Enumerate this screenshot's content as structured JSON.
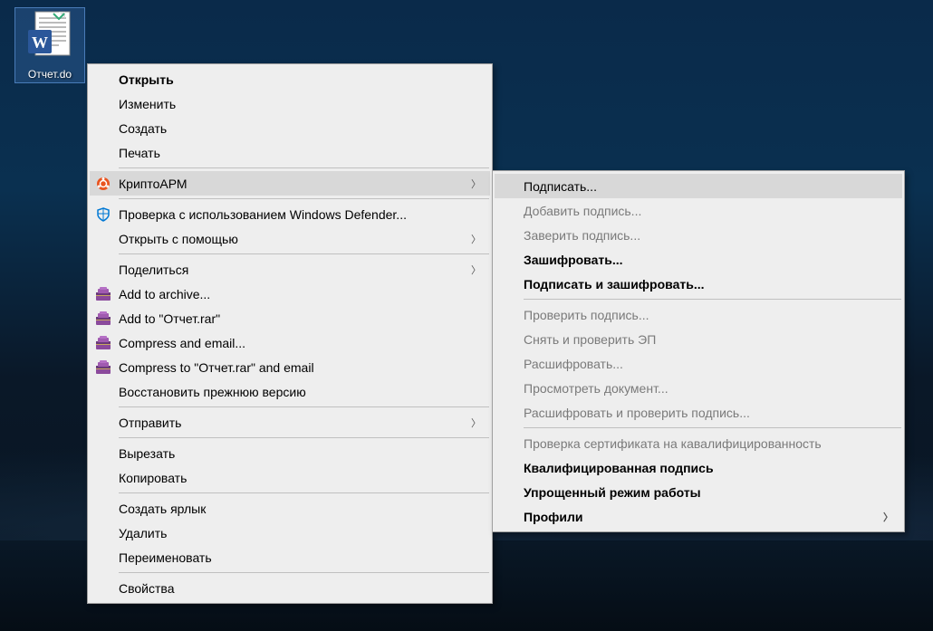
{
  "desktop": {
    "file_label": "Отчет.do"
  },
  "main_menu": {
    "open": "Открыть",
    "edit": "Изменить",
    "create": "Создать",
    "print": "Печать",
    "cryptoarm": "КриптоАРМ",
    "defender": "Проверка с использованием Windows Defender...",
    "open_with": "Открыть с помощью",
    "share": "Поделиться",
    "add_archive": "Add to archive...",
    "add_to_rar": "Add to \"Отчет.rar\"",
    "compress_email": "Compress and email...",
    "compress_to_email": "Compress to \"Отчет.rar\" and email",
    "restore": "Восстановить прежнюю версию",
    "send": "Отправить",
    "cut": "Вырезать",
    "copy": "Копировать",
    "shortcut": "Создать ярлык",
    "delete": "Удалить",
    "rename": "Переименовать",
    "properties": "Свойства"
  },
  "sub_menu": {
    "sign": "Подписать...",
    "add_sign": "Добавить подпись...",
    "certify_sign": "Заверить подпись...",
    "encrypt": "Зашифровать...",
    "sign_encrypt": "Подписать и зашифровать...",
    "check_sign": "Проверить подпись...",
    "remove_check": "Снять и проверить ЭП",
    "decrypt": "Расшифровать...",
    "view_doc": "Просмотреть документ...",
    "decrypt_check": "Расшифровать и проверить подпись...",
    "cert_check": "Проверка сертификата на кавалифицированность",
    "qualified": "Квалифицированная подпись",
    "simple_mode": "Упрощенный режим работы",
    "profiles": "Профили"
  }
}
